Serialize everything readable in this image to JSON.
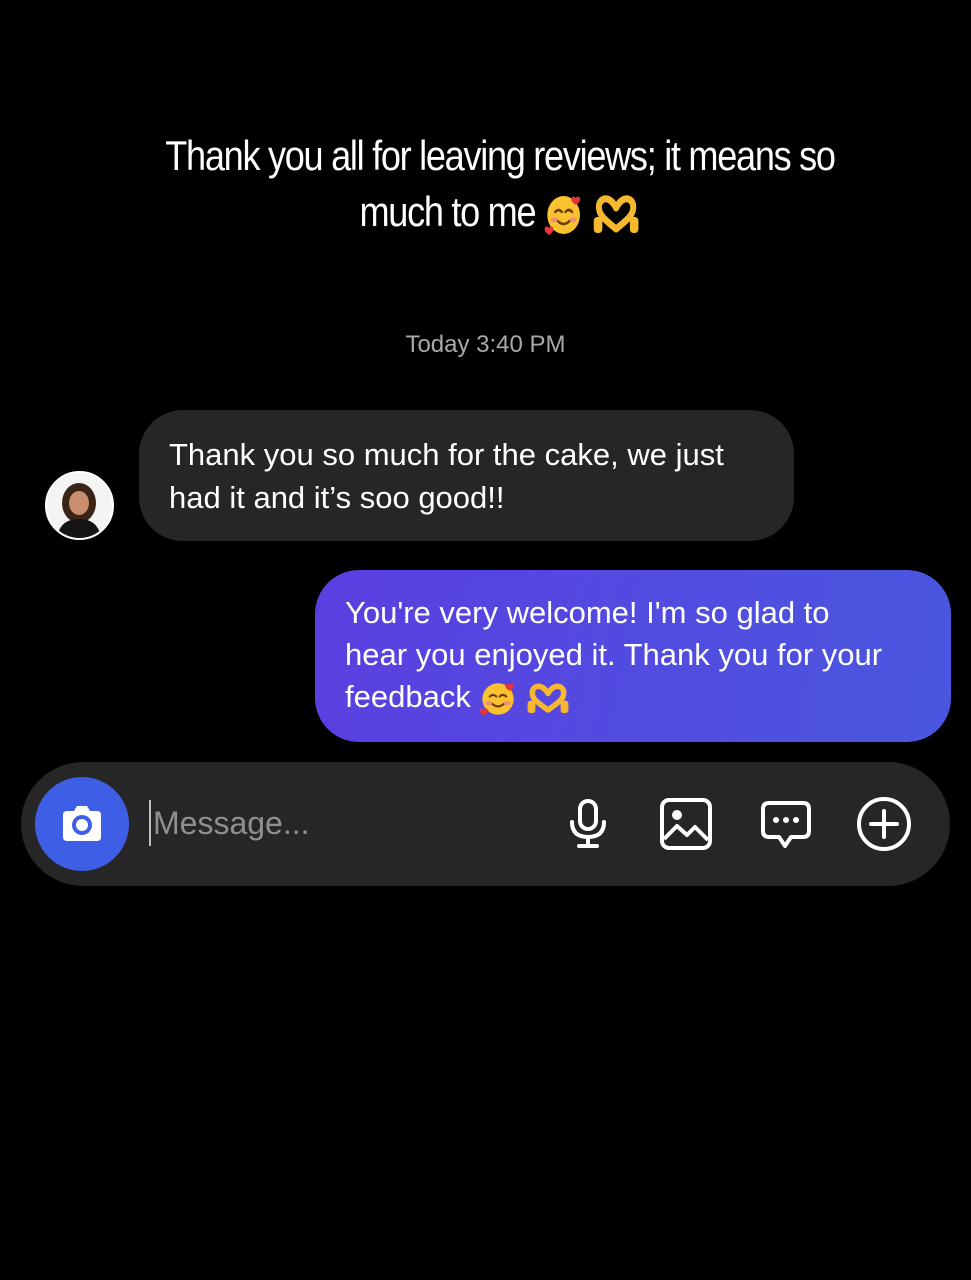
{
  "caption": {
    "line1": "Thank you all for leaving reviews; it means so",
    "line2": "much to me"
  },
  "caption_emojis": [
    "smiling-face-with-hearts-icon",
    "heart-hands-icon"
  ],
  "timestamp": "Today 3:40 PM",
  "messages": [
    {
      "direction": "incoming",
      "line1": "Thank you so much for the cake, we just",
      "line2": "had it and it’s soo good!!"
    },
    {
      "direction": "outgoing",
      "line1": "You're very welcome! I'm so glad to",
      "line2": "hear you enjoyed it. Thank you for your",
      "line3": "feedback",
      "emojis": [
        "smiling-face-with-hearts-icon",
        "heart-hands-icon"
      ]
    }
  ],
  "composer": {
    "placeholder": "Message...",
    "icons": [
      "camera-icon",
      "microphone-icon",
      "image-icon",
      "chat-bubble-icon",
      "plus-circle-icon"
    ]
  },
  "colors": {
    "background": "#000000",
    "incoming_bubble": "#262626",
    "outgoing_bubble_start": "#5a3fe0",
    "outgoing_bubble_end": "#4a57df",
    "camera_button": "#3f5ee6",
    "timestamp_text": "#a9a9a9"
  }
}
